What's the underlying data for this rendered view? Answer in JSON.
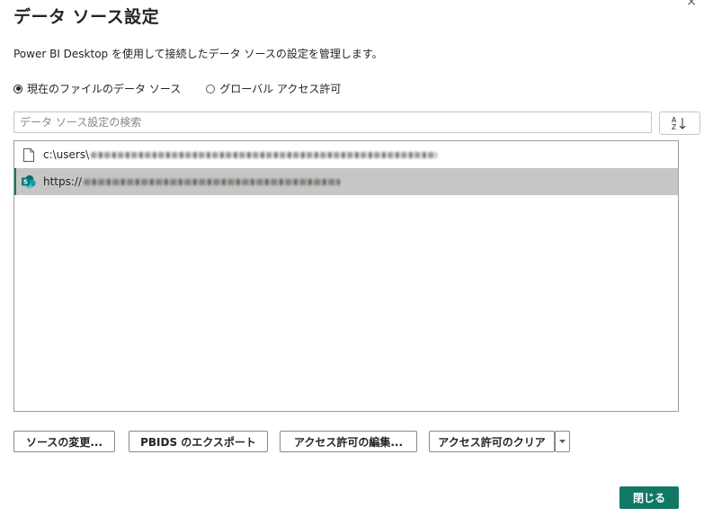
{
  "dialog": {
    "title": "データ ソース設定",
    "close_glyph": "×",
    "description": "Power BI Desktop を使用して接続したデータ ソースの設定を管理します。"
  },
  "scope": {
    "options": [
      {
        "label": "現在のファイルのデータ ソース",
        "checked": true
      },
      {
        "label": "グローバル アクセス許可",
        "checked": false
      }
    ]
  },
  "search": {
    "placeholder": "データ ソース設定の検索",
    "value": ""
  },
  "sort_icon": "sort-az-icon",
  "data_sources": [
    {
      "prefix": "c:\\users\\",
      "icon": "file-icon",
      "selected": false
    },
    {
      "prefix": "https://",
      "icon": "sharepoint-icon",
      "selected": true
    }
  ],
  "actions": {
    "change_source": "ソースの変更...",
    "export_pbids": "PBIDS のエクスポート",
    "edit_permissions": "アクセス許可の編集...",
    "clear_permissions": "アクセス許可のクリア",
    "close": "閉じる"
  },
  "colors": {
    "accent": "#117865",
    "selected_row": "#c8c6c4"
  }
}
